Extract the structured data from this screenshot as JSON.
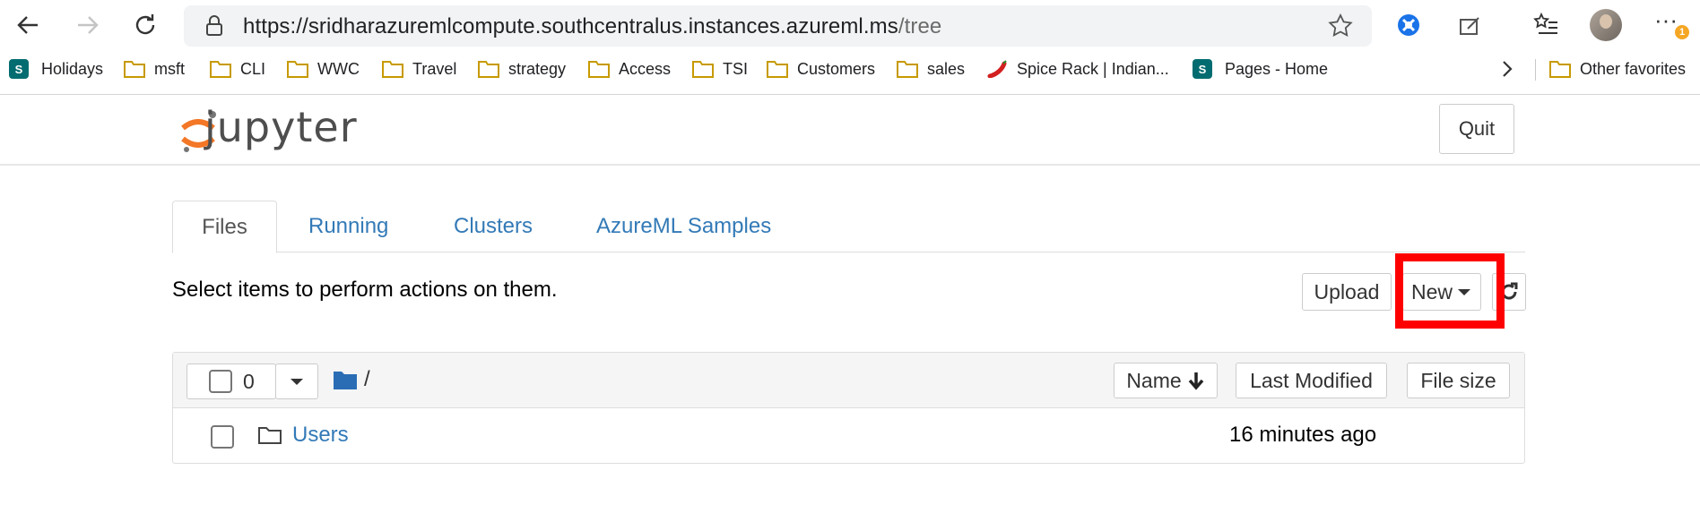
{
  "browser": {
    "url_host": "https://sridharazuremlcompute.southcentralus.instances.azureml.ms",
    "url_path": "/tree",
    "notification_count": "1",
    "more_label": "···"
  },
  "favorites": [
    {
      "label": "Holidays",
      "icon": "sharepoint-icon"
    },
    {
      "label": "msft",
      "icon": "folder-icon"
    },
    {
      "label": "CLI",
      "icon": "folder-icon"
    },
    {
      "label": "WWC",
      "icon": "folder-icon"
    },
    {
      "label": "Travel",
      "icon": "folder-icon"
    },
    {
      "label": "strategy",
      "icon": "folder-icon"
    },
    {
      "label": "Access",
      "icon": "folder-icon"
    },
    {
      "label": "TSI",
      "icon": "folder-icon"
    },
    {
      "label": "Customers",
      "icon": "folder-icon"
    },
    {
      "label": "sales",
      "icon": "folder-icon"
    },
    {
      "label": "Spice Rack | Indian...",
      "icon": "chili-icon"
    },
    {
      "label": "Pages - Home",
      "icon": "sharepoint-icon"
    }
  ],
  "other_favorites": "Other favorites",
  "jupyter": {
    "logo_text": "jupyter",
    "quit_label": "Quit",
    "tabs": [
      "Files",
      "Running",
      "Clusters",
      "AzureML Samples"
    ],
    "toolbar_hint": "Select items to perform actions on them.",
    "upload_label": "Upload",
    "new_label": "New",
    "selected_count": "0",
    "breadcrumb_path": "/",
    "columns": {
      "name": "Name",
      "last_modified": "Last Modified",
      "file_size": "File size"
    },
    "rows": [
      {
        "name": "Users",
        "last_modified": "16 minutes ago"
      }
    ]
  },
  "colors": {
    "link": "#337ab7",
    "highlight": "#ff0000",
    "folder": "#2a6db5"
  }
}
